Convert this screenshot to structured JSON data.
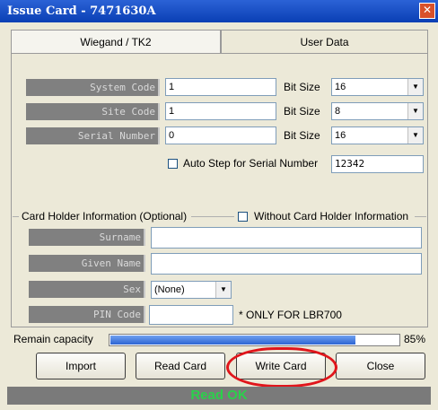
{
  "window": {
    "title": "Issue Card - 7471630A",
    "close_glyph": "✕"
  },
  "tabs": [
    {
      "label": "Wiegand / TK2",
      "active": true
    },
    {
      "label": "User Data",
      "active": false
    }
  ],
  "fields": {
    "system_code": {
      "label": "System Code",
      "value": "1",
      "bit_label": "Bit Size",
      "bit_value": "16"
    },
    "site_code": {
      "label": "Site Code",
      "value": "1",
      "bit_label": "Bit Size",
      "bit_value": "8"
    },
    "serial_number": {
      "label": "Serial Number",
      "value": "0",
      "bit_label": "Bit Size",
      "bit_value": "16"
    }
  },
  "auto_step": {
    "label": "Auto Step for Serial Number",
    "value": "12342",
    "checked": false
  },
  "card_holder": {
    "group_label": "Card Holder Information (Optional)",
    "without_label": "Without Card Holder Information",
    "without_checked": false,
    "surname": {
      "label": "Surname",
      "value": ""
    },
    "given_name": {
      "label": "Given Name",
      "value": ""
    },
    "sex": {
      "label": "Sex",
      "value": "(None)"
    },
    "pin": {
      "label": "PIN Code",
      "value": "",
      "note": "* ONLY FOR LBR700"
    }
  },
  "capacity": {
    "label": "Remain capacity",
    "percent_text": "85%",
    "fraction": 0.85
  },
  "buttons": {
    "import": "Import",
    "read": "Read Card",
    "write": "Write Card",
    "close": "Close"
  },
  "status": {
    "text": "Read OK",
    "color": "#2ad14a"
  },
  "dropdown_glyph": "▼",
  "colors": {
    "titlebar": "#0a3fb4",
    "highlight_circle": "#e0151b"
  }
}
